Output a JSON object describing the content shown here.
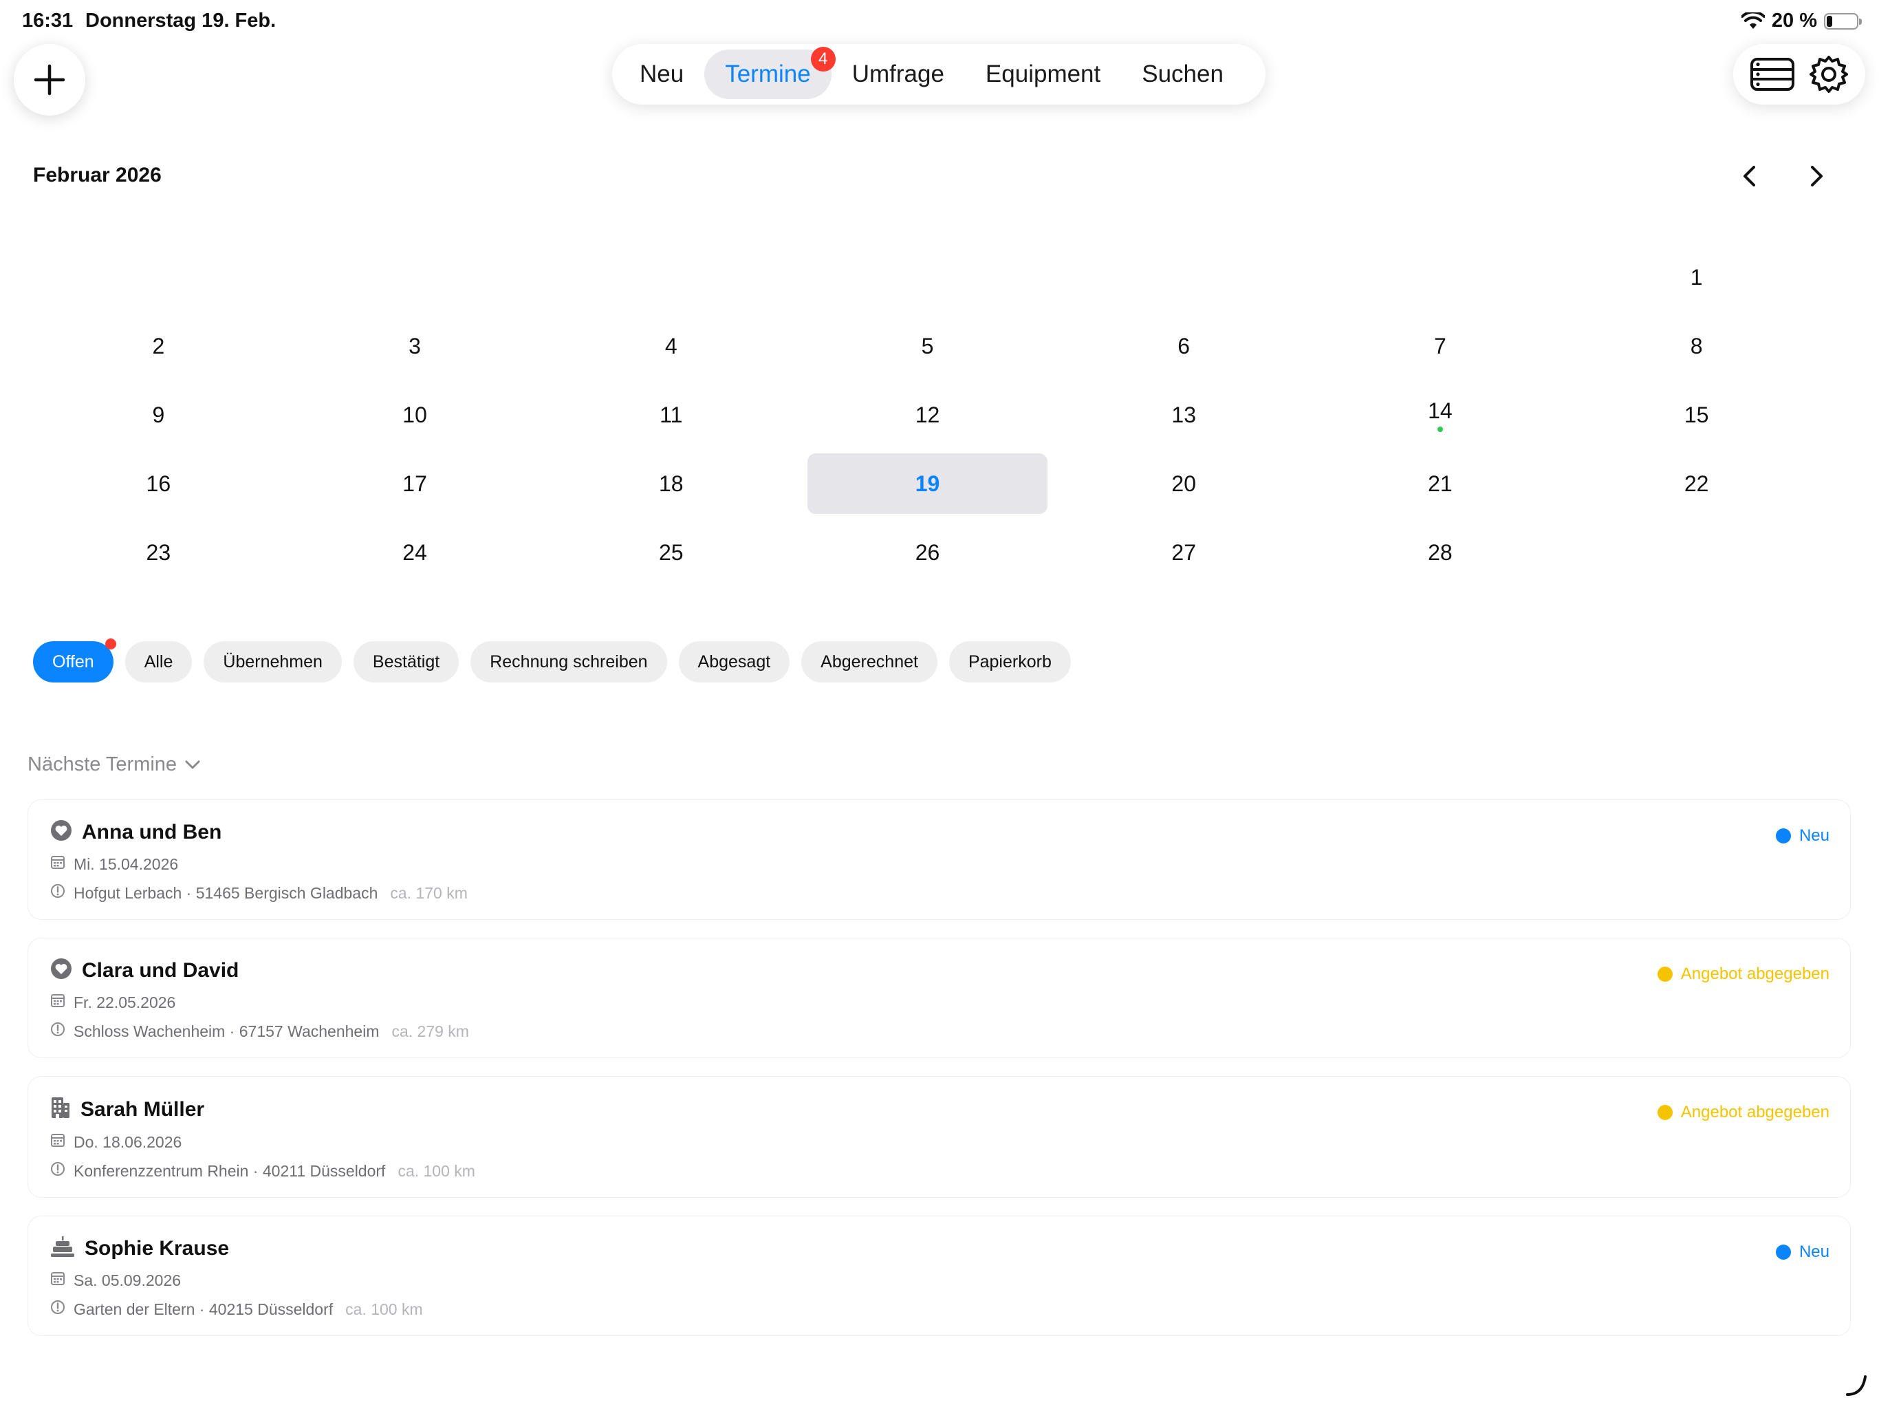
{
  "status_bar": {
    "time": "16:31",
    "date": "Donnerstag 19. Feb.",
    "battery_text": "20 %",
    "battery_level": 0.2
  },
  "tabs": [
    {
      "label": "Neu",
      "active": false
    },
    {
      "label": "Termine",
      "active": true,
      "badge": "4"
    },
    {
      "label": "Umfrage",
      "active": false
    },
    {
      "label": "Equipment",
      "active": false
    },
    {
      "label": "Suchen",
      "active": false
    }
  ],
  "calendar": {
    "month_title": "Februar 2026",
    "leading_blanks": 6,
    "days": [
      "1",
      "2",
      "3",
      "4",
      "5",
      "6",
      "7",
      "8",
      "9",
      "10",
      "11",
      "12",
      "13",
      "14",
      "15",
      "16",
      "17",
      "18",
      "19",
      "20",
      "21",
      "22",
      "23",
      "24",
      "25",
      "26",
      "27",
      "28"
    ],
    "selected_day": "19",
    "event_dot_days": [
      "14"
    ]
  },
  "filters": {
    "chips": [
      "Offen",
      "Alle",
      "Übernehmen",
      "Bestätigt",
      "Rechnung schreiben",
      "Abgesagt",
      "Abgerechnet",
      "Papierkorb"
    ],
    "active": "Offen"
  },
  "section": {
    "title": "Nächste Termine"
  },
  "appointments": [
    {
      "icon": "heart-icon",
      "title": "Anna und Ben",
      "date": "Mi. 15.04.2026",
      "location": "Hofgut Lerbach · 51465 Bergisch Gladbach",
      "distance": "ca. 170 km",
      "status": "Neu",
      "status_color": "#0a84ff"
    },
    {
      "icon": "heart-icon",
      "title": "Clara und David",
      "date": "Fr. 22.05.2026",
      "location": "Schloss Wachenheim · 67157 Wachenheim",
      "distance": "ca. 279 km",
      "status": "Angebot abgegeben",
      "status_color": "#f5c400"
    },
    {
      "icon": "building-icon",
      "title": "Sarah Müller",
      "date": "Do. 18.06.2026",
      "location": "Konferenzzentrum Rhein · 40211 Düsseldorf",
      "distance": "ca. 100 km",
      "status": "Angebot abgegeben",
      "status_color": "#f5c400"
    },
    {
      "icon": "cake-icon",
      "title": "Sophie Krause",
      "date": "Sa. 05.09.2026",
      "location": "Garten der Eltern · 40215 Düsseldorf",
      "distance": "ca. 100 km",
      "status": "Neu",
      "status_color": "#0a84ff"
    }
  ]
}
